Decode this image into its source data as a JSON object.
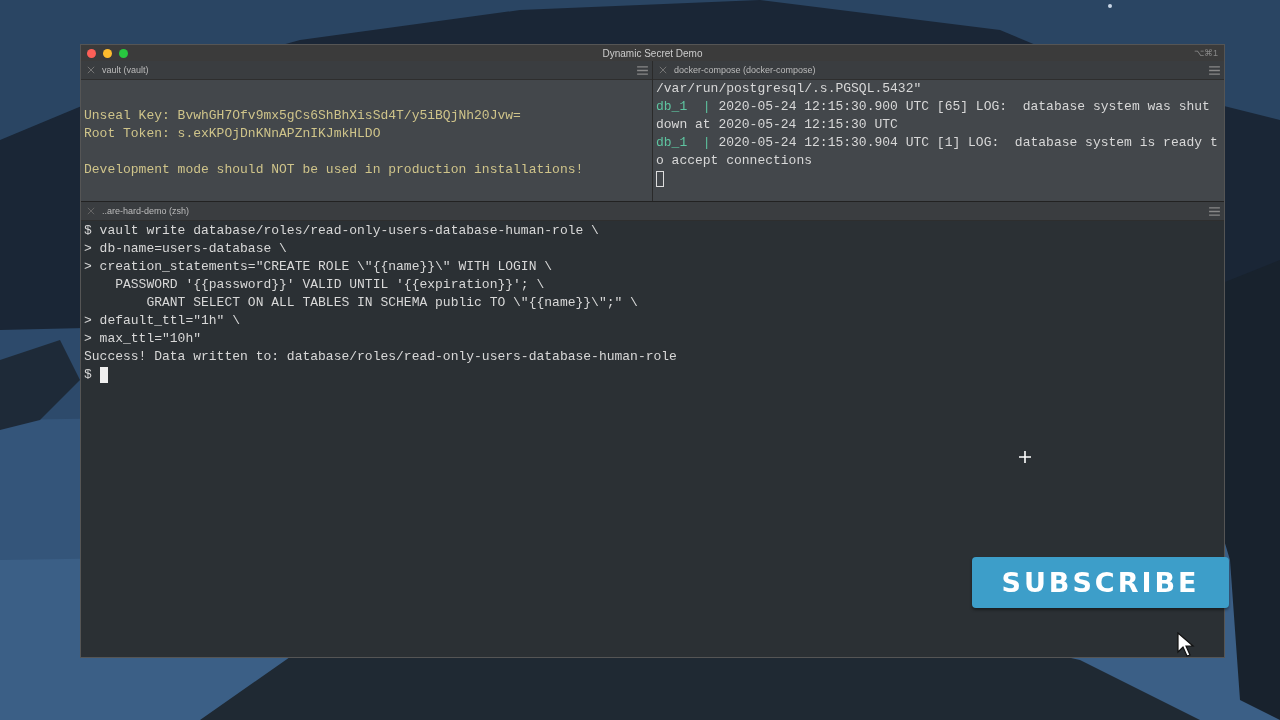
{
  "window": {
    "title": "Dynamic Secret Demo",
    "shortcut": "⌥⌘1"
  },
  "top_panes": [
    {
      "tab": "vault (vault)",
      "lines": [
        {
          "kind": "blank"
        },
        {
          "kind": "text",
          "segments": [
            {
              "kind": "warn",
              "text": "Unseal Key: BvwhGH7Ofv9mx5gCs6ShBhXisSd4T/y5iBQjNh20Jvw="
            }
          ]
        },
        {
          "kind": "text",
          "segments": [
            {
              "kind": "warn",
              "text": "Root Token: s.exKPOjDnKNnAPZnIKJmkHLDO"
            }
          ]
        },
        {
          "kind": "blank"
        },
        {
          "kind": "text",
          "segments": [
            {
              "kind": "warn",
              "text": "Development mode should NOT be used in production installations!"
            }
          ]
        }
      ]
    },
    {
      "tab": "docker-compose (docker-compose)",
      "lines": [
        {
          "kind": "text",
          "segments": [
            {
              "kind": "plain",
              "text": "/var/run/postgresql/.s.PGSQL.5432\""
            }
          ]
        },
        {
          "kind": "text",
          "segments": [
            {
              "kind": "tag",
              "text": "db_1  | "
            },
            {
              "kind": "plain",
              "text": "2020-05-24 12:15:30.900 UTC [65] LOG:  database system was shut"
            }
          ]
        },
        {
          "kind": "text",
          "segments": [
            {
              "kind": "plain",
              "text": "down at 2020-05-24 12:15:30 UTC"
            }
          ]
        },
        {
          "kind": "text",
          "segments": [
            {
              "kind": "tag",
              "text": "db_1  | "
            },
            {
              "kind": "plain",
              "text": "2020-05-24 12:15:30.904 UTC [1] LOG:  database system is ready t"
            }
          ]
        },
        {
          "kind": "text",
          "segments": [
            {
              "kind": "plain",
              "text": "o accept connections"
            }
          ]
        },
        {
          "kind": "text",
          "segments": [
            {
              "kind": "cursor",
              "focused": false
            }
          ]
        }
      ]
    }
  ],
  "bottom_pane": {
    "tab": "..are-hard-demo (zsh)",
    "lines": [
      {
        "kind": "text",
        "segments": [
          {
            "kind": "plain",
            "text": "$ vault write database/roles/read-only-users-database-human-role \\"
          }
        ]
      },
      {
        "kind": "text",
        "segments": [
          {
            "kind": "plain",
            "text": "> db-name=users-database \\"
          }
        ]
      },
      {
        "kind": "text",
        "segments": [
          {
            "kind": "plain",
            "text": "> creation_statements=\"CREATE ROLE \\\"{{name}}\\\" WITH LOGIN \\"
          }
        ]
      },
      {
        "kind": "text",
        "segments": [
          {
            "kind": "plain",
            "text": "    PASSWORD '{{password}}' VALID UNTIL '{{expiration}}'; \\"
          }
        ]
      },
      {
        "kind": "text",
        "segments": [
          {
            "kind": "plain",
            "text": "        GRANT SELECT ON ALL TABLES IN SCHEMA public TO \\\"{{name}}\\\";\" \\"
          }
        ]
      },
      {
        "kind": "text",
        "segments": [
          {
            "kind": "plain",
            "text": "> default_ttl=\"1h\" \\"
          }
        ]
      },
      {
        "kind": "text",
        "segments": [
          {
            "kind": "plain",
            "text": "> max_ttl=\"10h\""
          }
        ]
      },
      {
        "kind": "text",
        "segments": [
          {
            "kind": "plain",
            "text": "Success! Data written to: database/roles/read-only-users-database-human-role"
          }
        ]
      },
      {
        "kind": "text",
        "segments": [
          {
            "kind": "plain",
            "text": "$ "
          },
          {
            "kind": "cursor",
            "focused": true
          }
        ]
      }
    ]
  },
  "overlay_button": "SUBSCRIBE"
}
